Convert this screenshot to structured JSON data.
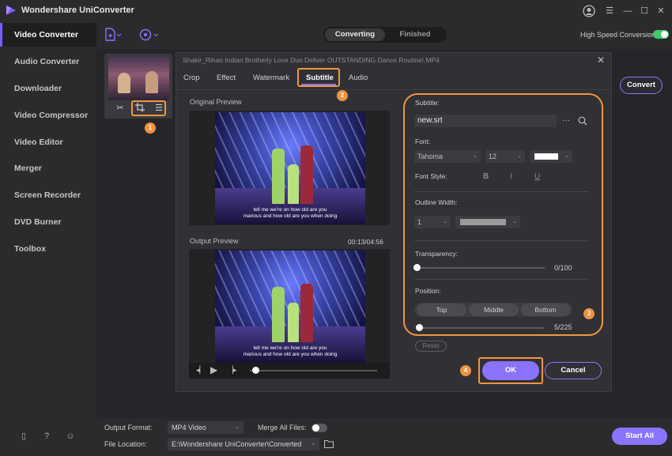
{
  "app": {
    "title": "Wondershare UniConverter",
    "accent": "#8a73ff",
    "highlight": "#f2963e"
  },
  "sidebar": {
    "items": [
      {
        "label": "Video Converter",
        "active": true
      },
      {
        "label": "Audio Converter"
      },
      {
        "label": "Downloader"
      },
      {
        "label": "Video Compressor"
      },
      {
        "label": "Video Editor"
      },
      {
        "label": "Merger"
      },
      {
        "label": "Screen Recorder"
      },
      {
        "label": "DVD Burner"
      },
      {
        "label": "Toolbox"
      }
    ]
  },
  "toolbar": {
    "tabs": [
      "Converting",
      "Finished"
    ],
    "active_tab": "Converting",
    "high_speed_label": "High Speed Conversion",
    "high_speed_on": true
  },
  "convert_label": "Convert",
  "dialog": {
    "filename": "Shakir_Rihan Indian Brotherly Love Duo Deliver OUTSTANDING Dance Routine!.MP4",
    "tabs": [
      "Crop",
      "Effect",
      "Watermark",
      "Subtitle",
      "Audio"
    ],
    "active_tab": "Subtitle",
    "original_preview": "Original Preview",
    "output_preview": "Output Preview",
    "time": "00:13/04:56",
    "caption_line1": "tell me we're on how old are you",
    "caption_line2": "marious and how old are you when doing",
    "subtitle": {
      "subtitle_label": "Subtitle:",
      "subtitle_file": "new.srt",
      "more": "···",
      "font_label": "Font:",
      "font_name": "Tahoma",
      "font_size": "12",
      "font_style_label": "Font Style:",
      "style_bold": "B",
      "style_italic": "I",
      "style_underline": "U",
      "outline_label": "Outline Width:",
      "outline_value": "1",
      "transparency_label": "Transparency:",
      "transparency_value": "0/100",
      "transparency": 0,
      "position_label": "Position:",
      "positions": [
        "Top",
        "Middle",
        "Bottom"
      ],
      "position_value": "5/225",
      "position_level": 5,
      "reset": "Reset"
    },
    "ok": "OK",
    "cancel": "Cancel"
  },
  "steps": [
    "1",
    "2",
    "3",
    "4"
  ],
  "bottom": {
    "output_format_label": "Output Format:",
    "output_format": "MP4 Video",
    "merge_label": "Merge All Files:",
    "merge_on": false,
    "file_location_label": "File Location:",
    "file_location": "E:\\Wondershare UniConverter\\Converted",
    "start_all": "Start All"
  }
}
